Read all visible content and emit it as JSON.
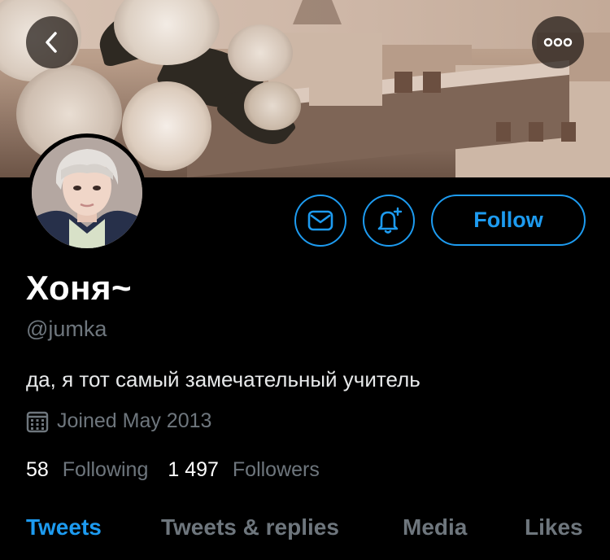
{
  "profile": {
    "name": "Хоня~",
    "handle": "@jumka",
    "bio": "да, я тот самый замечательный учитель",
    "joined": "Joined May 2013",
    "following_count": "58",
    "following_label": "Following",
    "followers_count": "1 497",
    "followers_label": "Followers"
  },
  "actions": {
    "follow_label": "Follow",
    "back_icon": "chevron-left-icon",
    "more_icon": "more-dots-icon",
    "message_icon": "envelope-icon",
    "notify_icon": "bell-plus-icon"
  },
  "tabs": [
    {
      "label": "Tweets",
      "active": true
    },
    {
      "label": "Tweets & replies",
      "active": false
    },
    {
      "label": "Media",
      "active": false
    },
    {
      "label": "Likes",
      "active": false
    }
  ],
  "colors": {
    "accent": "#1d9bf0",
    "muted": "#6e767d",
    "background": "#000000"
  }
}
